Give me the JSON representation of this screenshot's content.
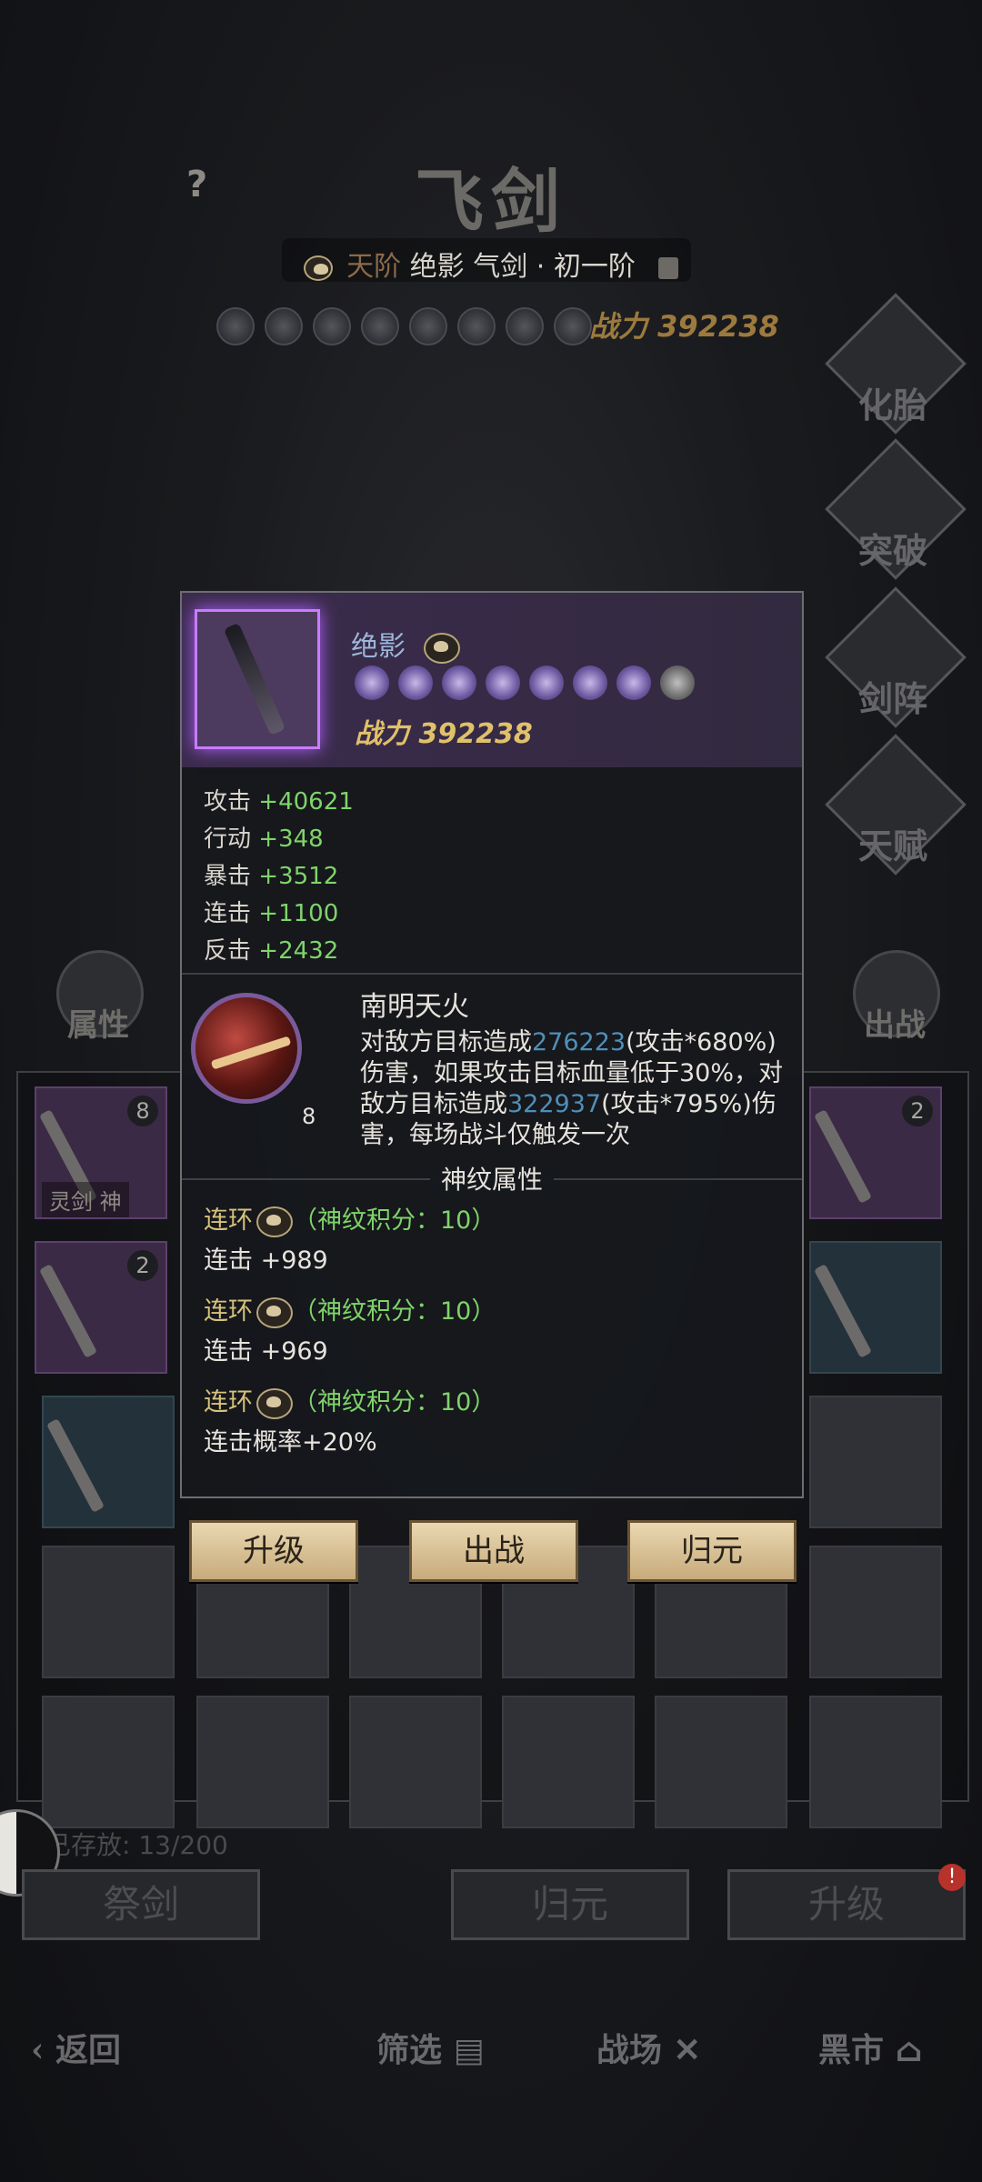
{
  "header": {
    "title": "飞剑",
    "help_glyph": "?",
    "tier": "天阶",
    "sword_name": "绝影",
    "sword_type": "气剑",
    "stage": "· 初一阶",
    "power_label": "战力",
    "power_value": "392238"
  },
  "side_menu": [
    {
      "label": "化胎"
    },
    {
      "label": "突破"
    },
    {
      "label": "剑阵"
    },
    {
      "label": "天赋"
    }
  ],
  "left_button": {
    "label": "属性"
  },
  "right_button": {
    "label": "出战"
  },
  "inventory": {
    "tag_label": "灵剑",
    "tag_label2": "神",
    "cell_counts": [
      "8",
      "2",
      "2"
    ],
    "stored_label": "已存放:",
    "stored_value": "13/200"
  },
  "bottom_buttons": {
    "sacrifice": "祭剑",
    "return": "归元",
    "upgrade": "升级",
    "badge": "!"
  },
  "nav": {
    "back": "返回",
    "filter": "筛选",
    "battle": "战场",
    "black_market": "黑市"
  },
  "popup": {
    "name": "绝影",
    "power_label": "战力",
    "power_value": "392238",
    "stats": [
      {
        "label": "攻击",
        "value": "+40621"
      },
      {
        "label": "行动",
        "value": "+348"
      },
      {
        "label": "暴击",
        "value": "+3512"
      },
      {
        "label": "连击",
        "value": "+1100"
      },
      {
        "label": "反击",
        "value": "+2432"
      }
    ],
    "skill": {
      "name": "南明天火",
      "level": "8",
      "desc_1": "对敌方目标造成",
      "dmg_1": "276223",
      "desc_2": "(攻击*680%)伤害，如果攻击目标血量低于30%，对敌方目标造成",
      "dmg_2": "322937",
      "desc_3": "(攻击*795%)伤害，每场战斗仅触发一次"
    },
    "rune_header": "神纹属性",
    "runes": [
      {
        "title": "连环",
        "score": "（神纹积分：10）",
        "effect": "连击 +989"
      },
      {
        "title": "连环",
        "score": "（神纹积分：10）",
        "effect": "连击 +969"
      },
      {
        "title": "连环",
        "score": "（神纹积分：10）",
        "effect": "连击概率+20%"
      }
    ],
    "actions": {
      "upgrade": "升级",
      "deploy": "出战",
      "return": "归元"
    }
  }
}
